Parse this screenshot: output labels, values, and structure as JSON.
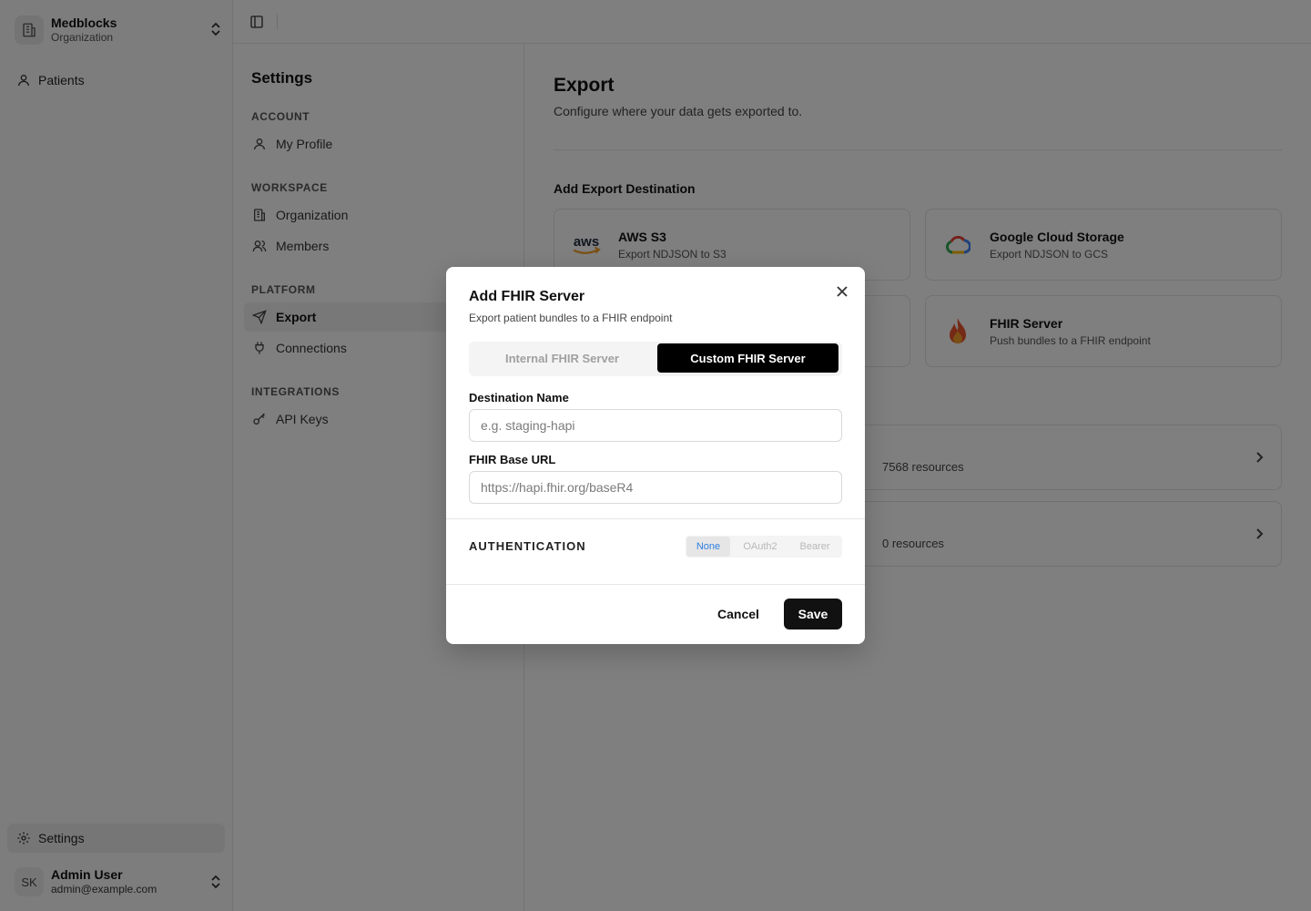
{
  "org": {
    "name": "Medblocks",
    "type": "Organization"
  },
  "sidebar": {
    "patients_label": "Patients",
    "settings_label": "Settings"
  },
  "user": {
    "initials": "SK",
    "name": "Admin User",
    "email": "admin@example.com"
  },
  "settings_nav": {
    "title": "Settings",
    "sections": [
      {
        "label": "ACCOUNT",
        "items": [
          {
            "label": "My Profile",
            "icon": "user-icon"
          }
        ]
      },
      {
        "label": "WORKSPACE",
        "items": [
          {
            "label": "Organization",
            "icon": "building-icon"
          },
          {
            "label": "Members",
            "icon": "users-icon"
          }
        ]
      },
      {
        "label": "PLATFORM",
        "items": [
          {
            "label": "Export",
            "icon": "send-icon",
            "active": true
          },
          {
            "label": "Connections",
            "icon": "plug-icon"
          }
        ]
      },
      {
        "label": "INTEGRATIONS",
        "items": [
          {
            "label": "API Keys",
            "icon": "key-icon"
          }
        ]
      }
    ]
  },
  "main": {
    "title": "Export",
    "description": "Configure where your data gets exported to.",
    "add_destination_title": "Add Export Destination",
    "destinations": [
      {
        "name": "AWS S3",
        "desc": "Export NDJSON to S3",
        "logo_text": "aws"
      },
      {
        "name": "Google Cloud Storage",
        "desc": "Export NDJSON to GCS"
      },
      {
        "name": "FHIR Server",
        "desc": "Push bundles to a FHIR endpoint"
      }
    ],
    "existing": [
      {
        "count_text": "7568 resources"
      },
      {
        "count_text": "0 resources"
      }
    ]
  },
  "modal": {
    "title": "Add FHIR Server",
    "subtitle": "Export patient bundles to a FHIR endpoint",
    "tabs": {
      "internal": "Internal FHIR Server",
      "custom": "Custom FHIR Server",
      "selected": "custom"
    },
    "destination_name": {
      "label": "Destination Name",
      "placeholder": "e.g. staging-hapi",
      "value": ""
    },
    "base_url": {
      "label": "FHIR Base URL",
      "placeholder": "https://hapi.fhir.org/baseR4",
      "value": ""
    },
    "authentication": {
      "label": "AUTHENTICATION",
      "options": [
        "None",
        "OAuth2",
        "Bearer"
      ],
      "selected": "None"
    },
    "cancel_label": "Cancel",
    "save_label": "Save"
  },
  "colors": {
    "accent_auth": "#2f7fe0",
    "primary_button": "#111111",
    "overlay": "rgba(0,0,0,0.5)"
  }
}
